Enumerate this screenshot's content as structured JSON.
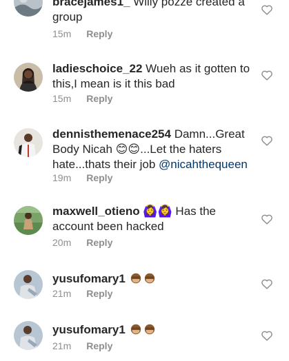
{
  "comments": [
    {
      "username": "bracejames1_",
      "text": " Willy pozze created a group",
      "time": "15m",
      "reply_label": "Reply",
      "avatar_icon": "avatar-landscape",
      "heart_icon": "heart-outline-icon"
    },
    {
      "username": "ladieschoice_22",
      "text": " Wueh as it gotten to this,I mean is it this bad",
      "time": "15m",
      "reply_label": "Reply",
      "avatar_icon": "avatar-woman",
      "heart_icon": "heart-outline-icon"
    },
    {
      "username": "dennisthemenace254",
      "text_a": " Damn...Great Body Nicah ",
      "emoji_a": "😊😊",
      "text_b": "...Let the haters hate...thats their job ",
      "mention": "@nicahthequeen",
      "time": "19m",
      "reply_label": "Reply",
      "avatar_icon": "avatar-man",
      "heart_icon": "heart-outline-icon"
    },
    {
      "username": "maxwell_otieno",
      "emoji_a": "🙆‍♀️🙆‍♀️",
      "text": " Has the account  been hacked",
      "time": "20m",
      "reply_label": "Reply",
      "avatar_icon": "avatar-outdoor",
      "heart_icon": "heart-outline-icon"
    },
    {
      "username": "yusufomary1",
      "emoji_a": "🙊🙊",
      "time": "21m",
      "reply_label": "Reply",
      "avatar_icon": "avatar-man-sitting",
      "heart_icon": "heart-outline-icon"
    },
    {
      "username": "yusufomary1",
      "emoji_a": "🙊🙊",
      "time": "21m",
      "reply_label": "Reply",
      "avatar_icon": "avatar-man-sitting",
      "heart_icon": "heart-outline-icon"
    }
  ],
  "colors": {
    "text": "#262626",
    "meta": "#8e8e8e",
    "mention": "#00376b",
    "emoji_face": "#f7b733",
    "monkey": "#8b5a2b"
  }
}
